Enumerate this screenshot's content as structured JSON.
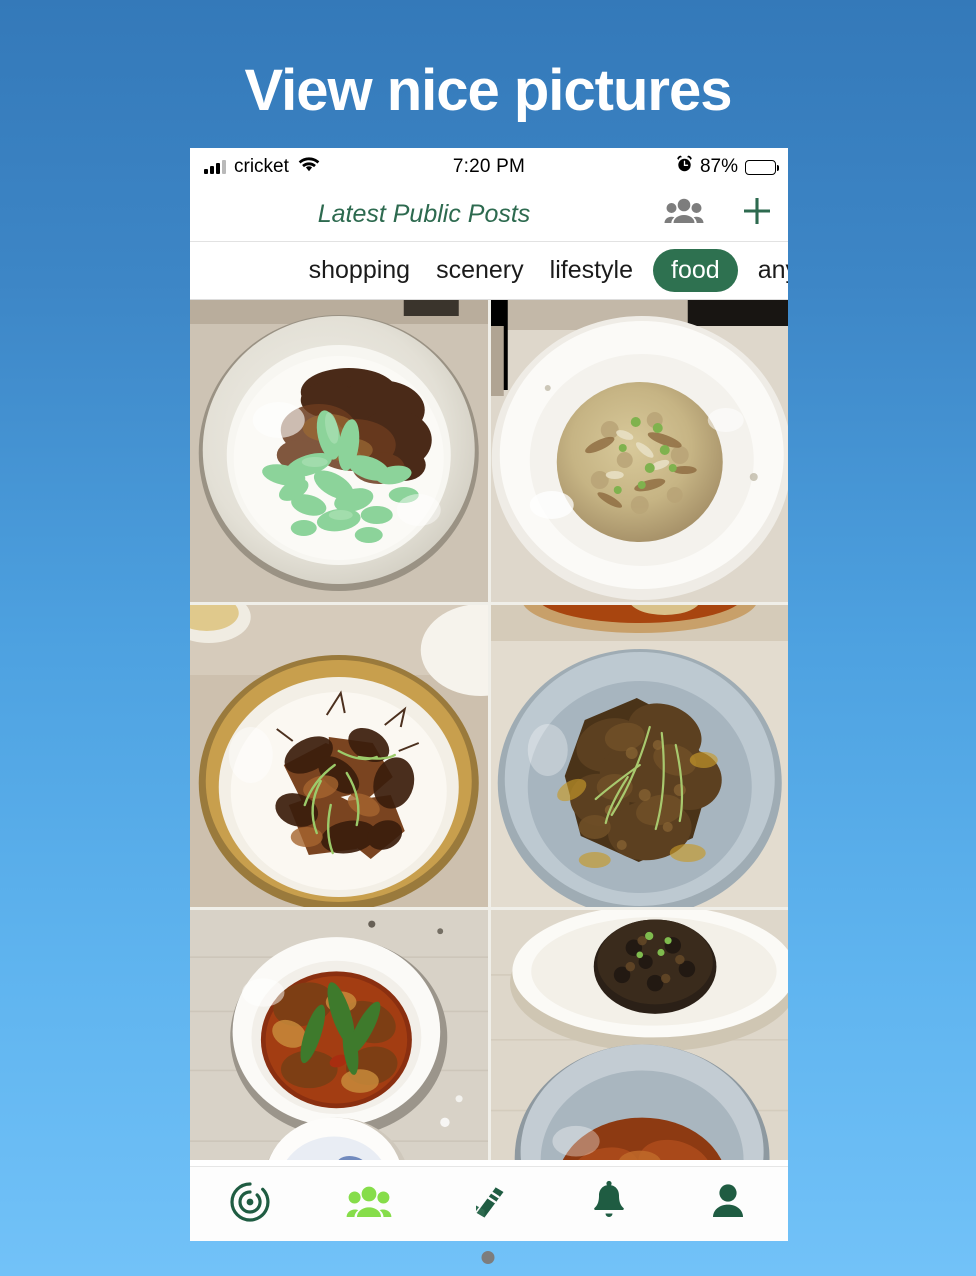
{
  "headline": "View nice pictures",
  "status_bar": {
    "carrier": "cricket",
    "signal_icon": "signal-bars-icon",
    "wifi_icon": "wifi-icon",
    "time": "7:20 PM",
    "alarm_icon": "alarm-clock-icon",
    "battery_percent": "87%",
    "battery_icon": "battery-icon"
  },
  "nav_bar": {
    "title": "Latest Public Posts",
    "people_icon": "people-group-icon",
    "add_icon": "plus-icon"
  },
  "filters": {
    "items": [
      {
        "label": "shopping",
        "selected": false
      },
      {
        "label": "scenery",
        "selected": false
      },
      {
        "label": "lifestyle",
        "selected": false
      },
      {
        "label": "food",
        "selected": true
      },
      {
        "label": "any",
        "selected": false
      }
    ],
    "selected_label": "food"
  },
  "photo_grid": {
    "items": [
      {
        "alt": "cendol green jelly noodles in coconut milk with palm sugar in grey bowl"
      },
      {
        "alt": "fried rice mound with spring onion on white plate"
      },
      {
        "alt": "grilled prawns with herbs in amber rimmed bowl"
      },
      {
        "alt": "beef rendang in blue grey bowl"
      },
      {
        "alt": "curry stew with long beans in white bowl beside blue rice"
      },
      {
        "alt": "black rice on white plate with braised meat in grey bowl"
      }
    ]
  },
  "tab_bar": {
    "items": [
      {
        "icon": "radar-icon",
        "active": false
      },
      {
        "icon": "people-icon",
        "active": true
      },
      {
        "icon": "book-icon",
        "active": false
      },
      {
        "icon": "bell-icon",
        "active": false
      },
      {
        "icon": "person-icon",
        "active": false
      }
    ]
  },
  "page_indicator": {
    "dots": 1,
    "active": 0
  },
  "colors": {
    "background_top": "#3479b9",
    "background_bottom": "#72c2f8",
    "brand_green": "#2d6a4f",
    "chip_selected": "#2e7150",
    "tab_active": "#86dd4a",
    "tab_inactive": "#1f5c42",
    "headline": "#ffffff"
  }
}
